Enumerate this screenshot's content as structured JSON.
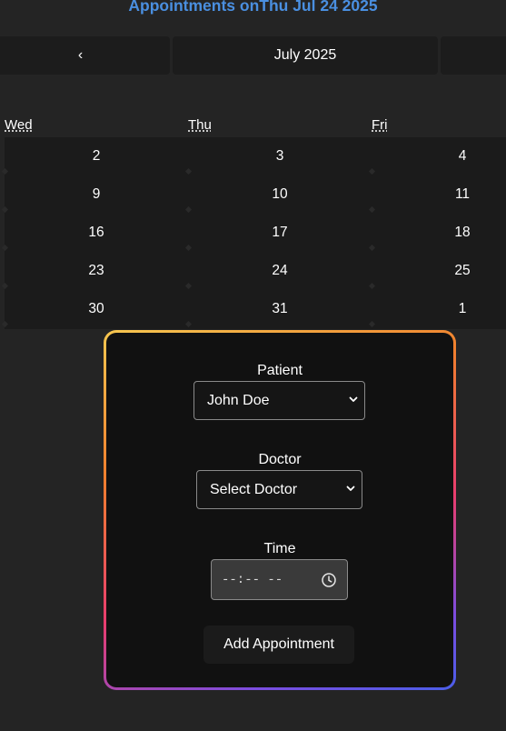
{
  "title": "Appointments onThu Jul 24 2025",
  "calendar": {
    "prev_label": "‹",
    "month_label": "July 2025",
    "weekdays": [
      "Wed",
      "Thu",
      "Fri"
    ],
    "weeks": [
      [
        "2",
        "3",
        "4"
      ],
      [
        "9",
        "10",
        "11"
      ],
      [
        "16",
        "17",
        "18"
      ],
      [
        "23",
        "24",
        "25"
      ],
      [
        "30",
        "31",
        "1"
      ]
    ]
  },
  "form": {
    "patient_label": "Patient",
    "patient_value": "John Doe",
    "doctor_label": "Doctor",
    "doctor_value": "Select Doctor",
    "time_label": "Time",
    "time_placeholder": "--:-- --",
    "submit_label": "Add Appointment"
  },
  "colors": {
    "background": "#242424",
    "title": "#4a8fe0",
    "card_border_gradient": [
      "#f6c750",
      "#f0802e",
      "#e83d6e",
      "#7b4de0",
      "#4a5ee8"
    ]
  },
  "icons": {
    "select_arrow": "chevron-down-icon",
    "time": "clock-icon"
  }
}
